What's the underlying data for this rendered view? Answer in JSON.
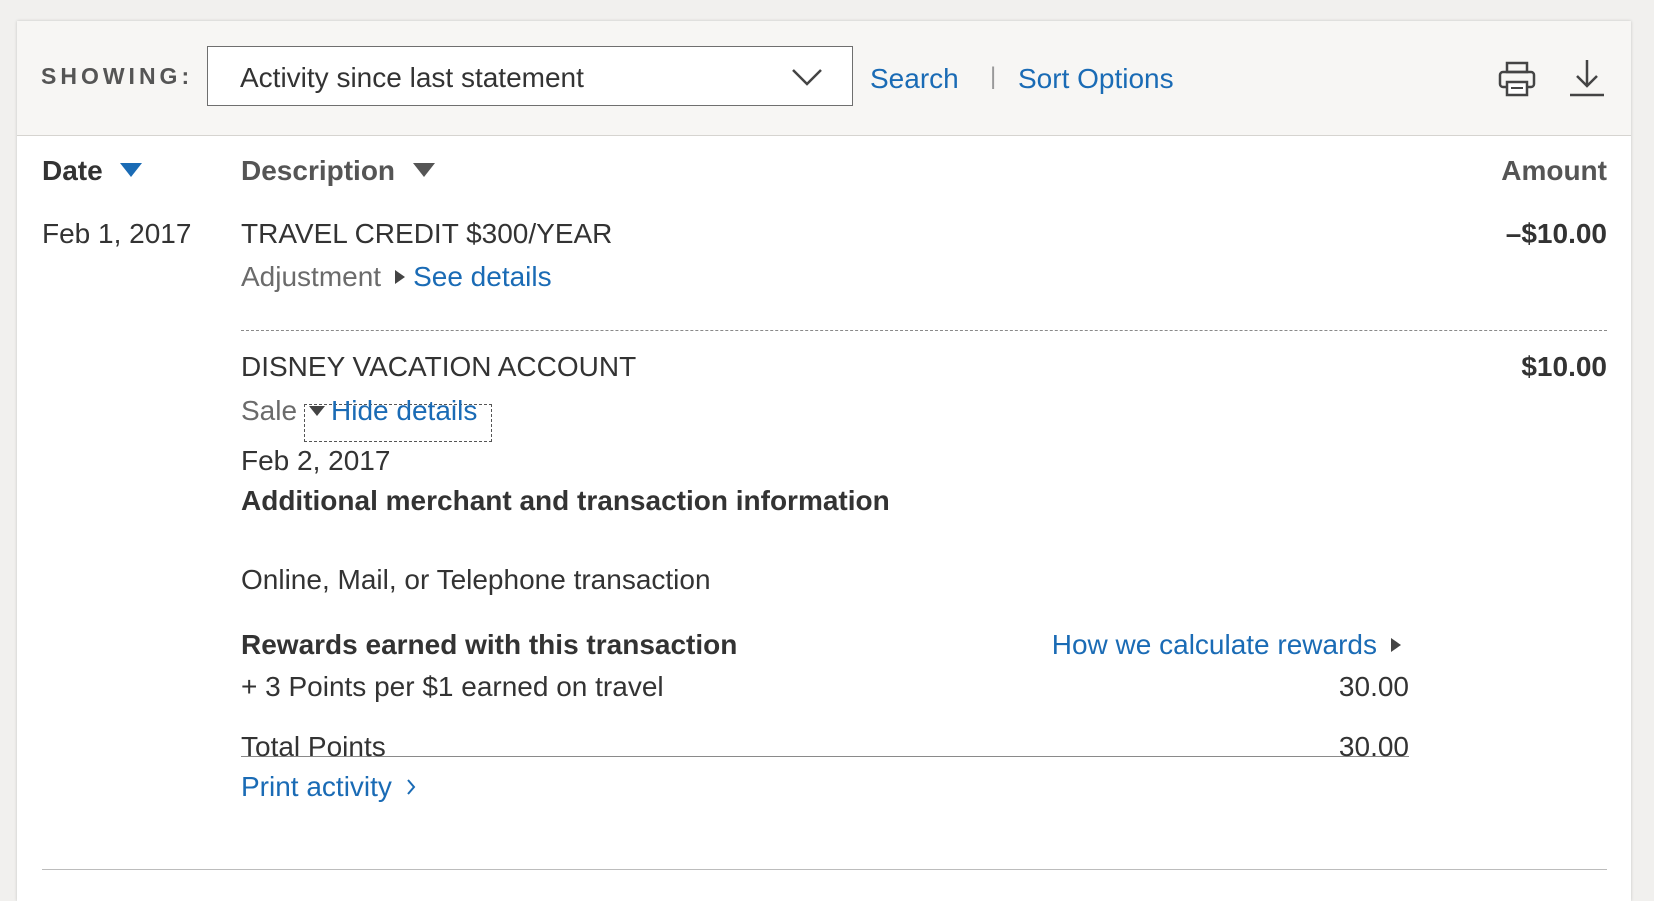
{
  "toolbar": {
    "showing_label": "SHOWING:",
    "filter_value": "Activity since last statement",
    "search_label": "Search",
    "separator": "|",
    "sort_label": "Sort Options",
    "print_icon": "print-icon",
    "download_icon": "download-icon"
  },
  "table_headers": {
    "date": "Date",
    "description": "Description",
    "amount": "Amount"
  },
  "transactions": [
    {
      "date": "Feb 1, 2017",
      "description": "TRAVEL CREDIT $300/YEAR",
      "type": "Adjustment",
      "details_link": "See details",
      "amount": "–$10.00"
    },
    {
      "description": "DISNEY VACATION ACCOUNT",
      "type": "Sale",
      "details_link": "Hide details",
      "amount": "$10.00",
      "details": {
        "date": "Feb 2, 2017",
        "heading": "Additional merchant and transaction information",
        "channel": "Online, Mail, or Telephone transaction",
        "rewards_heading": "Rewards earned with this transaction",
        "rewards_link": "How we calculate rewards",
        "rewards_line": "+ 3 Points per $1 earned on travel",
        "rewards_value": "30.00",
        "total_label": "Total Points",
        "total_value": "30.00",
        "print_link": "Print activity"
      }
    }
  ],
  "colors": {
    "link": "#1a6bb5",
    "sort_arrow_active": "#1a6bb5",
    "sort_arrow_inactive": "#555555"
  }
}
